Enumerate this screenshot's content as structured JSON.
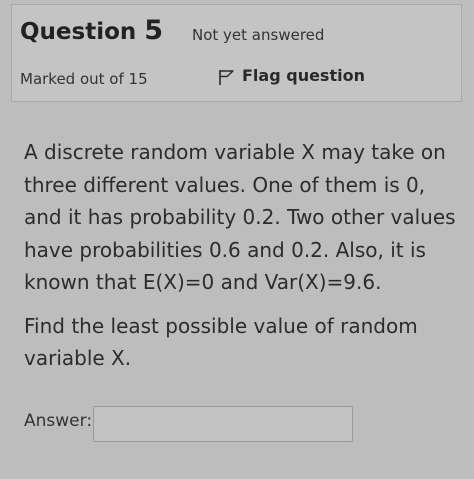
{
  "question_info": {
    "title_prefix": "Question",
    "number": "5",
    "status": "Not yet answered",
    "marks": "Marked out of 15",
    "flag_label": "Flag question",
    "flag_icon": "flag-outline-icon"
  },
  "question": {
    "paragraph1": "A discrete random variable X may take on three different values. One of them is 0, and it has probability 0.2. Two other values have probabilities 0.6 and 0.2. Also, it is known that E(X)=0 and Var(X)=9.6.",
    "paragraph2": "Find the least possible value of random variable X."
  },
  "answer": {
    "label": "Answer:",
    "value": ""
  },
  "colors": {
    "background": "#bdbdbd",
    "info_box": "#c4c4c4",
    "text": "#2a2a2a"
  }
}
